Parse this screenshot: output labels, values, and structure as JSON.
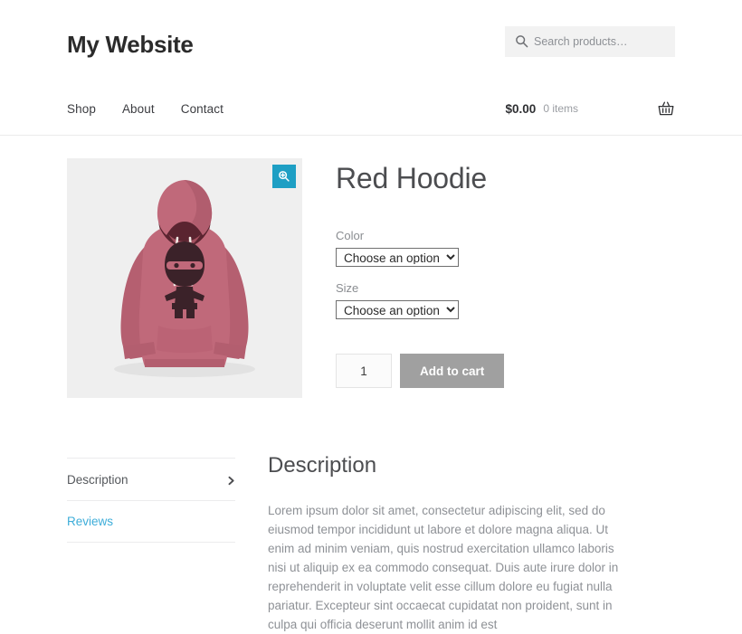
{
  "header": {
    "site_title": "My Website",
    "search": {
      "placeholder": "Search products…",
      "value": "",
      "icon": "search-icon"
    },
    "nav": [
      {
        "label": "Shop"
      },
      {
        "label": "About"
      },
      {
        "label": "Contact"
      }
    ],
    "cart": {
      "amount": "$0.00",
      "items": "0 items",
      "icon": "shopping-basket-icon"
    }
  },
  "product": {
    "title": "Red Hoodie",
    "gallery": {
      "image_alt": "Red hoodie with dark ninja character graphic",
      "zoom_button_icon": "magnifier-plus-icon",
      "zoom_button_color": "#1e9fc4",
      "background_color": "#efefef",
      "hoodie_color": "#c0697a",
      "hoodie_shadow_color": "#a3505f",
      "hood_inner_color": "#5a2430",
      "graphic_color": "#3b2229",
      "drawstring_color": "#f2eae6"
    },
    "attributes": [
      {
        "label": "Color",
        "name": "color-select",
        "selected": "Choose an option",
        "options": [
          "Choose an option"
        ]
      },
      {
        "label": "Size",
        "name": "size-select",
        "selected": "Choose an option",
        "options": [
          "Choose an option"
        ]
      }
    ],
    "quantity": "1",
    "add_to_cart_label": "Add to cart",
    "add_to_cart_color": "#a0a0a0"
  },
  "tabs": [
    {
      "label": "Description",
      "active": true,
      "icon": "chevron-right-icon"
    },
    {
      "label": "Reviews",
      "active": false,
      "color": "#3dadd9"
    }
  ],
  "description": {
    "heading": "Description",
    "body": "Lorem ipsum dolor sit amet, consectetur adipiscing elit, sed do eiusmod tempor incididunt ut labore et dolore magna aliqua. Ut enim ad minim veniam, quis nostrud exercitation ullamco laboris nisi ut aliquip ex ea commodo consequat. Duis aute irure dolor in reprehenderit in voluptate velit esse cillum dolore eu fugiat nulla pariatur. Excepteur sint occaecat cupidatat non proident, sunt in culpa qui officia deserunt mollit anim id est"
  }
}
